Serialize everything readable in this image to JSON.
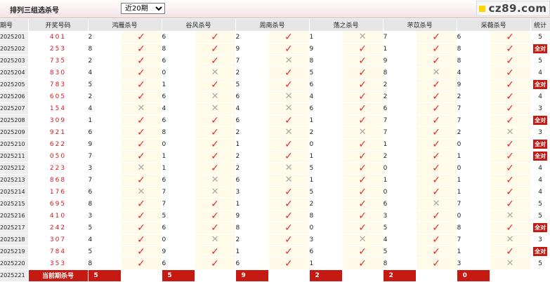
{
  "header": {
    "title": "排列三组选杀号",
    "range_select": {
      "value": "近20期",
      "options": [
        "近20期"
      ]
    },
    "logo_text": "cz89.com"
  },
  "columns": {
    "issue": "期号",
    "number": "开奖号码",
    "experts": [
      "鸿雁杀号",
      "谷风杀号",
      "周南杀号",
      "荡之杀号",
      "芣苡杀号",
      "采薇杀号"
    ],
    "stat": "统计"
  },
  "rows": [
    {
      "issue": "2025201",
      "number": "401",
      "kills": [
        2,
        6,
        2,
        1,
        7,
        6
      ],
      "hits": [
        true,
        true,
        true,
        false,
        true,
        true
      ],
      "stat": "5"
    },
    {
      "issue": "2025202",
      "number": "253",
      "kills": [
        8,
        8,
        9,
        9,
        1,
        8
      ],
      "hits": [
        true,
        true,
        true,
        true,
        true,
        true
      ],
      "stat": "全对"
    },
    {
      "issue": "2025203",
      "number": "735",
      "kills": [
        2,
        6,
        7,
        8,
        9,
        8
      ],
      "hits": [
        true,
        true,
        false,
        true,
        true,
        true
      ],
      "stat": "5"
    },
    {
      "issue": "2025204",
      "number": "830",
      "kills": [
        4,
        0,
        2,
        5,
        8,
        4
      ],
      "hits": [
        true,
        false,
        true,
        true,
        false,
        true
      ],
      "stat": "4"
    },
    {
      "issue": "2025205",
      "number": "783",
      "kills": [
        5,
        1,
        5,
        6,
        2,
        9
      ],
      "hits": [
        true,
        true,
        true,
        true,
        true,
        true
      ],
      "stat": "全对"
    },
    {
      "issue": "2025206",
      "number": "605",
      "kills": [
        2,
        6,
        6,
        4,
        2,
        2
      ],
      "hits": [
        true,
        false,
        false,
        true,
        true,
        true
      ],
      "stat": "4"
    },
    {
      "issue": "2025207",
      "number": "154",
      "kills": [
        4,
        4,
        4,
        6,
        6,
        7
      ],
      "hits": [
        false,
        false,
        false,
        true,
        true,
        true
      ],
      "stat": "3"
    },
    {
      "issue": "2025208",
      "number": "309",
      "kills": [
        1,
        6,
        6,
        1,
        7,
        7
      ],
      "hits": [
        true,
        true,
        true,
        true,
        true,
        true
      ],
      "stat": "全对"
    },
    {
      "issue": "2025209",
      "number": "921",
      "kills": [
        6,
        8,
        2,
        2,
        7,
        2
      ],
      "hits": [
        true,
        true,
        false,
        false,
        true,
        false
      ],
      "stat": "3"
    },
    {
      "issue": "2025210",
      "number": "622",
      "kills": [
        9,
        0,
        1,
        0,
        1,
        0
      ],
      "hits": [
        true,
        true,
        true,
        true,
        true,
        true
      ],
      "stat": "全对"
    },
    {
      "issue": "2025211",
      "number": "050",
      "kills": [
        7,
        1,
        2,
        1,
        2,
        1
      ],
      "hits": [
        true,
        true,
        true,
        true,
        true,
        true
      ],
      "stat": "全对"
    },
    {
      "issue": "2025212",
      "number": "223",
      "kills": [
        3,
        1,
        2,
        5,
        0,
        0
      ],
      "hits": [
        false,
        true,
        false,
        true,
        true,
        true
      ],
      "stat": "4"
    },
    {
      "issue": "2025213",
      "number": "868",
      "kills": [
        7,
        6,
        6,
        1,
        1,
        1
      ],
      "hits": [
        true,
        false,
        false,
        true,
        true,
        true
      ],
      "stat": "4"
    },
    {
      "issue": "2025214",
      "number": "176",
      "kills": [
        6,
        7,
        3,
        5,
        0,
        1
      ],
      "hits": [
        false,
        false,
        true,
        true,
        true,
        true
      ],
      "stat": "4"
    },
    {
      "issue": "2025215",
      "number": "695",
      "kills": [
        8,
        7,
        1,
        2,
        6,
        7
      ],
      "hits": [
        true,
        true,
        true,
        true,
        false,
        true
      ],
      "stat": "5"
    },
    {
      "issue": "2025216",
      "number": "410",
      "kills": [
        3,
        5,
        9,
        8,
        3,
        0
      ],
      "hits": [
        true,
        true,
        true,
        true,
        true,
        false
      ],
      "stat": "5"
    },
    {
      "issue": "2025217",
      "number": "242",
      "kills": [
        5,
        6,
        8,
        0,
        5,
        8
      ],
      "hits": [
        true,
        true,
        true,
        true,
        true,
        true
      ],
      "stat": "全对"
    },
    {
      "issue": "2025218",
      "number": "307",
      "kills": [
        4,
        0,
        2,
        3,
        4,
        7
      ],
      "hits": [
        true,
        false,
        true,
        false,
        true,
        false
      ],
      "stat": "3"
    },
    {
      "issue": "2025219",
      "number": "784",
      "kills": [
        5,
        9,
        1,
        6,
        5,
        1
      ],
      "hits": [
        true,
        true,
        true,
        true,
        true,
        true
      ],
      "stat": "全对"
    },
    {
      "issue": "2025220",
      "number": "353",
      "kills": [
        8,
        6,
        6,
        1,
        8,
        3
      ],
      "hits": [
        true,
        true,
        true,
        true,
        true,
        false
      ],
      "stat": "5"
    }
  ],
  "current": {
    "issue": "2025221",
    "label": "当前期杀号",
    "predictions": [
      "5",
      "5",
      "9",
      "2",
      "2",
      "0"
    ]
  },
  "colors": {
    "accent_red": "#c61912",
    "check_red": "#e8282f",
    "cross_gray": "#a8a8a8",
    "mark_bg": "#fffbe8"
  },
  "icons": {
    "hit": "check-icon",
    "miss": "cross-icon"
  }
}
